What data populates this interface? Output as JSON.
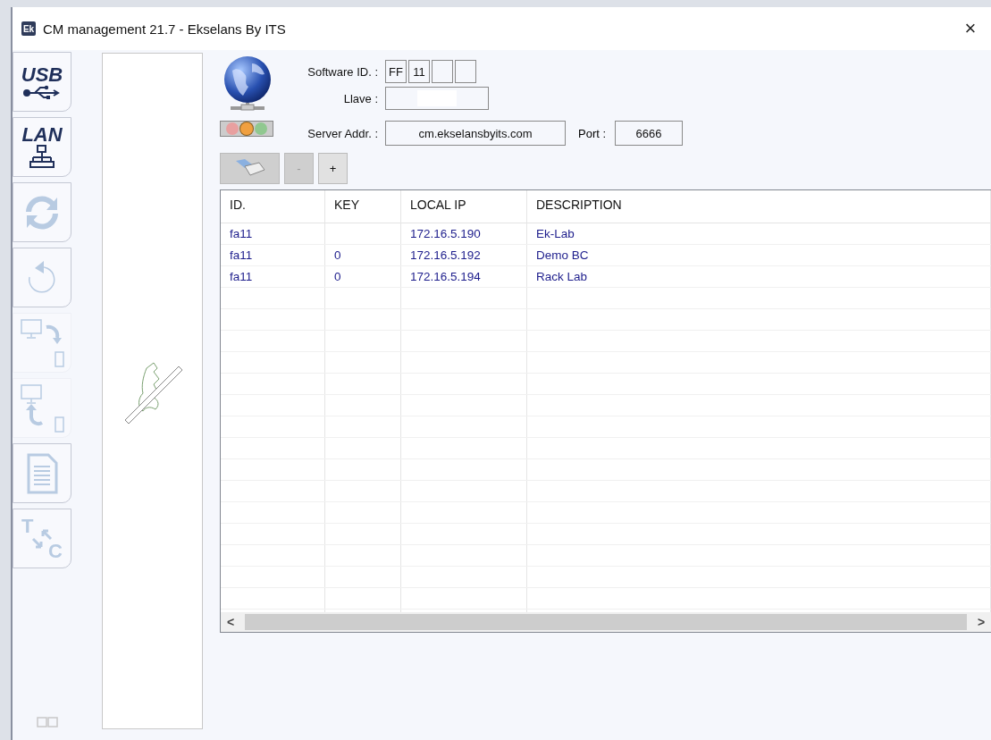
{
  "window": {
    "icon_text": "Ek",
    "title": "CM management 21.7 - Ekselans By ITS",
    "close": "×"
  },
  "toolbar": [
    {
      "kind": "usb",
      "label": "USB",
      "disabled": false
    },
    {
      "kind": "lan",
      "label": "LAN",
      "disabled": false
    },
    {
      "kind": "refresh",
      "disabled": true
    },
    {
      "kind": "undo",
      "disabled": true
    },
    {
      "kind": "upload",
      "disabled": true
    },
    {
      "kind": "download",
      "disabled": true
    },
    {
      "kind": "document",
      "disabled": true
    },
    {
      "kind": "text-case",
      "letters": [
        "T",
        "C"
      ],
      "disabled": true
    }
  ],
  "status_lights": [
    {
      "color": "#e8a0a0",
      "on": false
    },
    {
      "color": "#f0a040",
      "on": true
    },
    {
      "color": "#90c890",
      "on": false
    }
  ],
  "form": {
    "software_id_label": "Software ID. :",
    "software_id": [
      {
        "value": "FF"
      },
      {
        "value": "11"
      },
      {
        "empty": true
      },
      {
        "empty": true
      }
    ],
    "key_label": "Llave :",
    "server_label": "Server Addr. :",
    "server": "cm.ekselansbyits.com",
    "port_label": "Port :",
    "port": "6666"
  },
  "buttons": [
    {
      "kind": "usb",
      "disabled": true
    },
    {
      "kind": "text",
      "label": "-",
      "disabled": true
    },
    {
      "kind": "text",
      "label": "+",
      "disabled": false
    }
  ],
  "table": {
    "columns": [
      "ID.",
      "KEY",
      "LOCAL IP",
      "DESCRIPTION"
    ],
    "rows": [
      [
        "fa11",
        "",
        "172.16.5.190",
        "Ek-Lab"
      ],
      [
        "fa11",
        "0",
        "172.16.5.192",
        "Demo BC"
      ],
      [
        "fa11",
        "0",
        "172.16.5.194",
        "Rack Lab"
      ]
    ],
    "scroll_left": "<",
    "scroll_right": ">"
  }
}
